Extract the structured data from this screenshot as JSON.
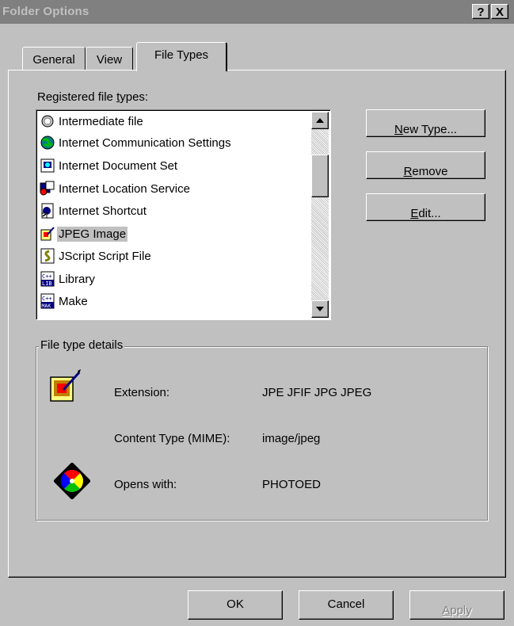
{
  "window": {
    "title": "Folder Options",
    "help_label": "?",
    "close_label": "X"
  },
  "tabs": [
    {
      "label": "General",
      "active": false
    },
    {
      "label": "View",
      "active": false
    },
    {
      "label": "File Types",
      "active": true
    }
  ],
  "registered": {
    "label_pre": "Registered file ",
    "label_ul": "t",
    "label_post": "ypes:",
    "items": [
      {
        "label": "Intermediate file",
        "icon": "intermediate-file-icon"
      },
      {
        "label": "Internet Communication Settings",
        "icon": "internet-globe-icon"
      },
      {
        "label": "Internet Document Set",
        "icon": "document-set-icon"
      },
      {
        "label": "Internet Location Service",
        "icon": "location-service-icon"
      },
      {
        "label": "Internet Shortcut",
        "icon": "internet-shortcut-icon"
      },
      {
        "label": "JPEG Image",
        "icon": "jpeg-image-icon",
        "selected": true
      },
      {
        "label": "JScript Script File",
        "icon": "script-file-icon"
      },
      {
        "label": "Library",
        "icon": "lib-icon",
        "badge": "LIB"
      },
      {
        "label": "Make",
        "icon": "mak-icon",
        "badge": "MAK"
      }
    ]
  },
  "buttons": {
    "new_type": {
      "ul": "N",
      "rest": "ew Type..."
    },
    "remove": {
      "ul": "R",
      "rest": "emove"
    },
    "edit": {
      "ul": "E",
      "rest": "dit..."
    },
    "ok": "OK",
    "cancel": "Cancel",
    "apply": {
      "ul": "A",
      "rest": "pply"
    }
  },
  "details": {
    "group_label": "File type details",
    "extension_label": "Extension:",
    "extension_value": "JPE JFIF JPG JPEG",
    "content_type_label": "Content Type (MIME):",
    "content_type_value": "image/jpeg",
    "opens_with_label": "Opens with:",
    "opens_with_value": "PHOTOED"
  },
  "colors": {
    "face": "#c0c0c0",
    "title_inactive": "#808080",
    "shadow": "#808080",
    "highlight": "#ffffff"
  }
}
